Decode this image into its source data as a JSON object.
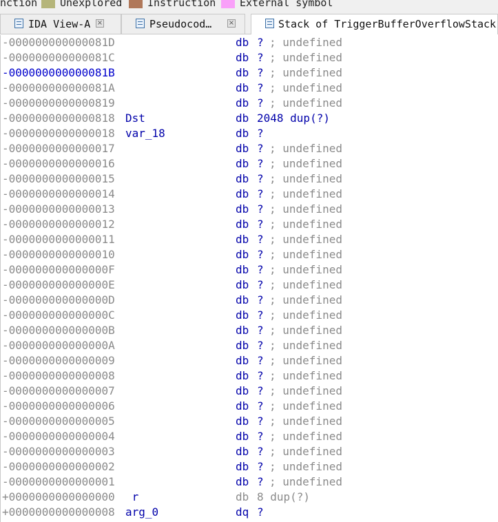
{
  "legend": {
    "items": [
      {
        "label": "nction",
        "color": ""
      },
      {
        "label": "Unexplored",
        "color": "#b5b57a"
      },
      {
        "label": "Instruction",
        "color": "#b0785a"
      },
      {
        "label": "External symbol",
        "color": "#f9a0f9"
      }
    ]
  },
  "tabs": [
    {
      "label": "IDA View-A",
      "close": "×",
      "active": false
    },
    {
      "label": "Pseudocod…",
      "close": "×",
      "active": false
    },
    {
      "label": "Stack of TriggerBufferOverflowStack",
      "active": true
    }
  ],
  "rows": [
    {
      "offset": "-000000000000081D",
      "name": "",
      "type": "db",
      "value": "?",
      "comment": "; undefined"
    },
    {
      "offset": "-000000000000081C",
      "name": "",
      "type": "db",
      "value": "?",
      "comment": "; undefined"
    },
    {
      "offset": "-000000000000081B",
      "name": "",
      "type": "db",
      "value": "?",
      "comment": "; undefined",
      "highlight": true
    },
    {
      "offset": "-000000000000081A",
      "name": "",
      "type": "db",
      "value": "?",
      "comment": "; undefined"
    },
    {
      "offset": "-0000000000000819",
      "name": "",
      "type": "db",
      "value": "?",
      "comment": "; undefined"
    },
    {
      "offset": "-0000000000000818",
      "name": "Dst",
      "type": "db",
      "value": "2048 dup(?)",
      "comment": ""
    },
    {
      "offset": "-0000000000000018",
      "name": "var_18",
      "type": "db",
      "value": "?",
      "comment": ""
    },
    {
      "offset": "-0000000000000017",
      "name": "",
      "type": "db",
      "value": "?",
      "comment": "; undefined"
    },
    {
      "offset": "-0000000000000016",
      "name": "",
      "type": "db",
      "value": "?",
      "comment": "; undefined"
    },
    {
      "offset": "-0000000000000015",
      "name": "",
      "type": "db",
      "value": "?",
      "comment": "; undefined"
    },
    {
      "offset": "-0000000000000014",
      "name": "",
      "type": "db",
      "value": "?",
      "comment": "; undefined"
    },
    {
      "offset": "-0000000000000013",
      "name": "",
      "type": "db",
      "value": "?",
      "comment": "; undefined"
    },
    {
      "offset": "-0000000000000012",
      "name": "",
      "type": "db",
      "value": "?",
      "comment": "; undefined"
    },
    {
      "offset": "-0000000000000011",
      "name": "",
      "type": "db",
      "value": "?",
      "comment": "; undefined"
    },
    {
      "offset": "-0000000000000010",
      "name": "",
      "type": "db",
      "value": "?",
      "comment": "; undefined"
    },
    {
      "offset": "-000000000000000F",
      "name": "",
      "type": "db",
      "value": "?",
      "comment": "; undefined"
    },
    {
      "offset": "-000000000000000E",
      "name": "",
      "type": "db",
      "value": "?",
      "comment": "; undefined"
    },
    {
      "offset": "-000000000000000D",
      "name": "",
      "type": "db",
      "value": "?",
      "comment": "; undefined"
    },
    {
      "offset": "-000000000000000C",
      "name": "",
      "type": "db",
      "value": "?",
      "comment": "; undefined"
    },
    {
      "offset": "-000000000000000B",
      "name": "",
      "type": "db",
      "value": "?",
      "comment": "; undefined"
    },
    {
      "offset": "-000000000000000A",
      "name": "",
      "type": "db",
      "value": "?",
      "comment": "; undefined"
    },
    {
      "offset": "-0000000000000009",
      "name": "",
      "type": "db",
      "value": "?",
      "comment": "; undefined"
    },
    {
      "offset": "-0000000000000008",
      "name": "",
      "type": "db",
      "value": "?",
      "comment": "; undefined"
    },
    {
      "offset": "-0000000000000007",
      "name": "",
      "type": "db",
      "value": "?",
      "comment": "; undefined"
    },
    {
      "offset": "-0000000000000006",
      "name": "",
      "type": "db",
      "value": "?",
      "comment": "; undefined"
    },
    {
      "offset": "-0000000000000005",
      "name": "",
      "type": "db",
      "value": "?",
      "comment": "; undefined"
    },
    {
      "offset": "-0000000000000004",
      "name": "",
      "type": "db",
      "value": "?",
      "comment": "; undefined"
    },
    {
      "offset": "-0000000000000003",
      "name": "",
      "type": "db",
      "value": "?",
      "comment": "; undefined"
    },
    {
      "offset": "-0000000000000002",
      "name": "",
      "type": "db",
      "value": "?",
      "comment": "; undefined"
    },
    {
      "offset": "-0000000000000001",
      "name": "",
      "type": "db",
      "value": "?",
      "comment": "; undefined"
    },
    {
      "offset": "+0000000000000000",
      "name": " r",
      "type": "db",
      "value": "8 dup(?)",
      "comment": "",
      "dim": true
    },
    {
      "offset": "+0000000000000008",
      "name": "arg_0",
      "type": "dq",
      "value": "?",
      "comment": ""
    }
  ]
}
